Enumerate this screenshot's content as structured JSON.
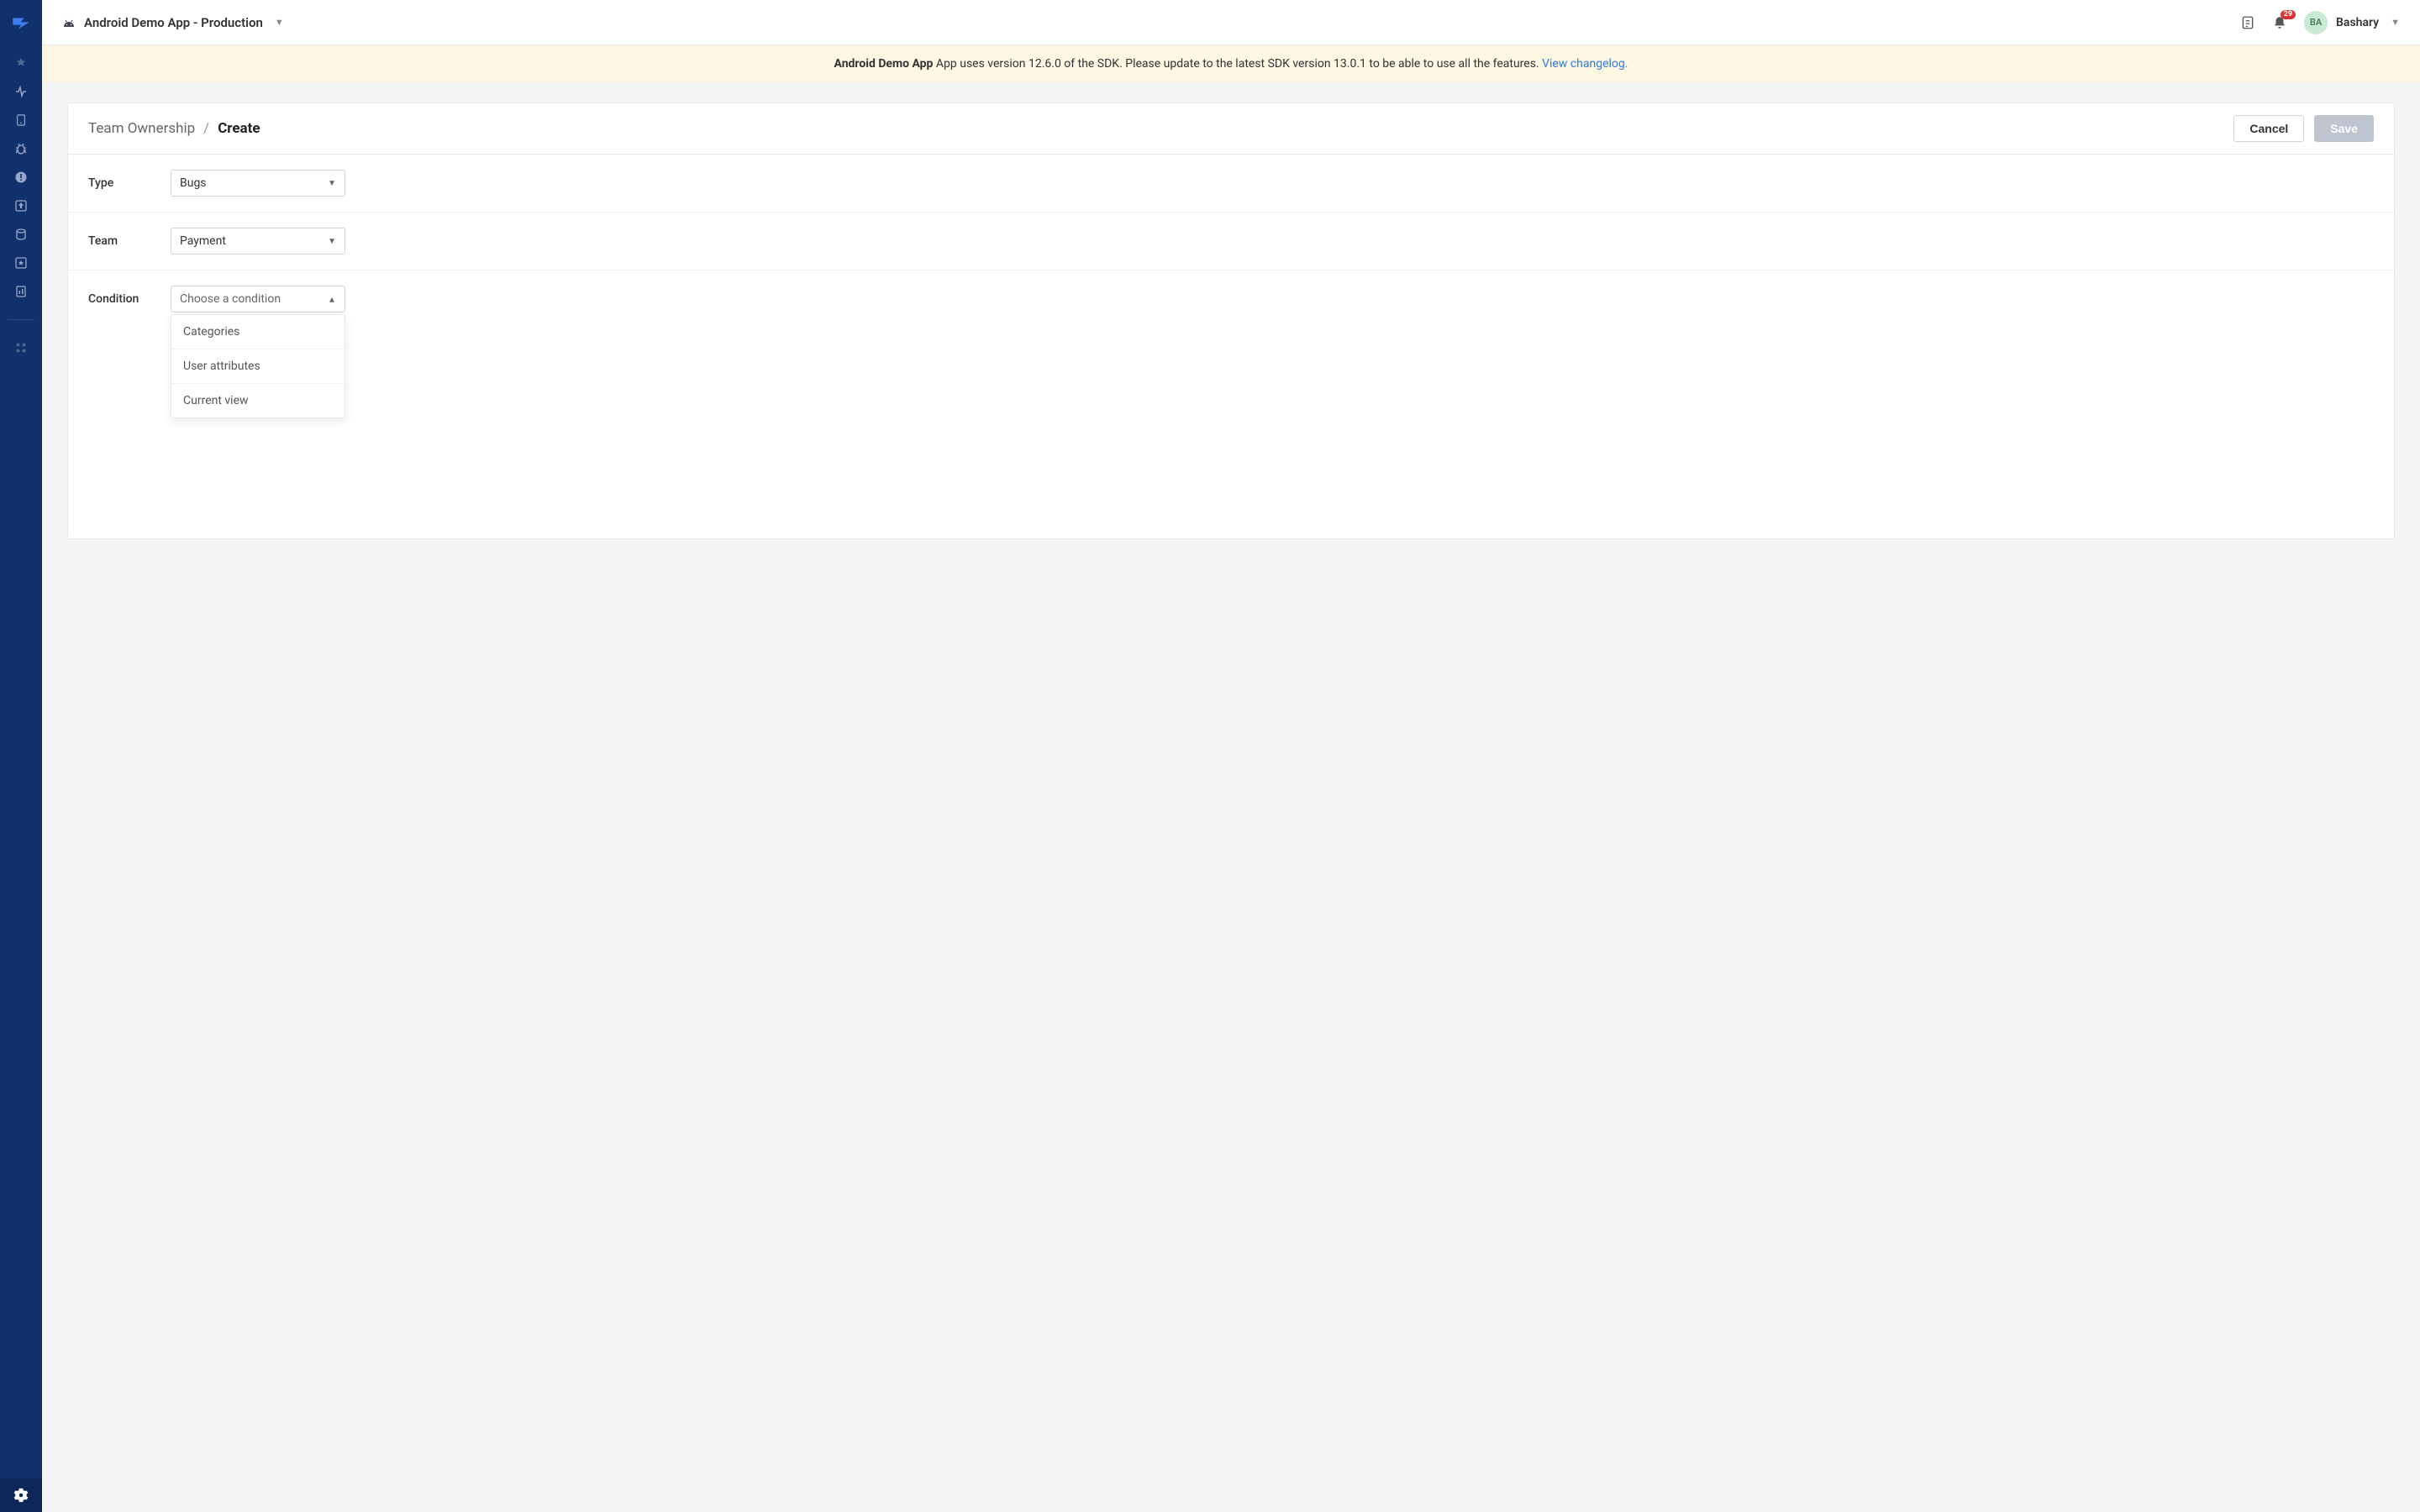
{
  "topbar": {
    "app_name": "Android Demo App - Production",
    "notification_count": "29",
    "user_initials": "BA",
    "user_name": "Bashary"
  },
  "banner": {
    "bold": "Android Demo App",
    "text": " App uses version 12.6.0 of the SDK. Please update to the latest SDK version 13.0.1 to be able to use all the features. ",
    "link": "View changelog."
  },
  "breadcrumb": {
    "parent": "Team Ownership",
    "sep": "/",
    "current": "Create"
  },
  "actions": {
    "cancel": "Cancel",
    "save": "Save"
  },
  "form": {
    "type_label": "Type",
    "type_value": "Bugs",
    "team_label": "Team",
    "team_value": "Payment",
    "condition_label": "Condition",
    "condition_placeholder": "Choose a condition"
  },
  "condition_options": {
    "opt0": "Categories",
    "opt1": "User attributes",
    "opt2": "Current view"
  }
}
